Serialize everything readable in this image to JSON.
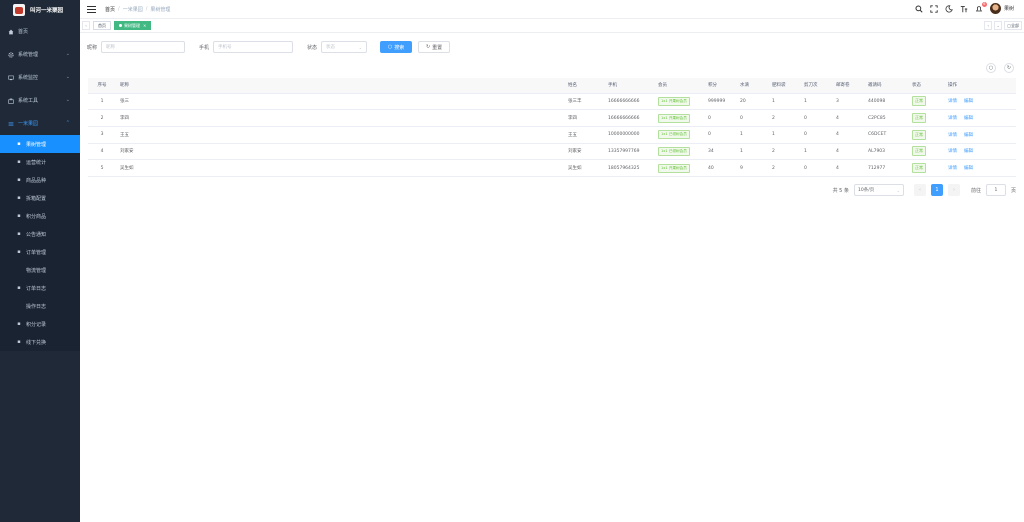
{
  "app": {
    "title": "叫河一米栗园"
  },
  "sidebar": {
    "items": [
      {
        "label": "首页",
        "icon": "home-icon"
      },
      {
        "label": "系统管理",
        "icon": "gear-icon"
      },
      {
        "label": "系统监控",
        "icon": "monitor-icon"
      },
      {
        "label": "系统工具",
        "icon": "toolbox-icon"
      },
      {
        "label": "一米果园",
        "icon": "orchard-icon"
      }
    ],
    "submenu": [
      {
        "label": "果树管理",
        "icon": "user-icon",
        "active": true,
        "deep": false
      },
      {
        "label": "运营统计",
        "icon": "chart-icon",
        "active": false,
        "deep": false
      },
      {
        "label": "商品品种",
        "icon": "list-icon",
        "active": false,
        "deep": false
      },
      {
        "label": "拆箱配置",
        "icon": "edit-icon",
        "active": false,
        "deep": false
      },
      {
        "label": "积分商品",
        "icon": "cart-icon",
        "active": false,
        "deep": false
      },
      {
        "label": "公告通知",
        "icon": "message-icon",
        "active": false,
        "deep": false
      },
      {
        "label": "订单管理",
        "icon": "document-icon",
        "active": false,
        "deep": false
      },
      {
        "label": "物流管理",
        "icon": "",
        "active": false,
        "deep": true
      },
      {
        "label": "订单日志",
        "icon": "log-icon",
        "active": false,
        "deep": false
      },
      {
        "label": "操作日志",
        "icon": "",
        "active": false,
        "deep": true
      },
      {
        "label": "积分记录",
        "icon": "star-icon",
        "active": false,
        "deep": false
      },
      {
        "label": "线下兑换",
        "icon": "send-icon",
        "active": false,
        "deep": false
      }
    ]
  },
  "header": {
    "breadcrumb": [
      "首页",
      "一米果园",
      "果树管理"
    ],
    "username": "果树",
    "notification_count": "6"
  },
  "tags": {
    "items": [
      "首页",
      "果树管理"
    ],
    "close_all": "全部"
  },
  "search": {
    "nickname_label": "昵称",
    "nickname_placeholder": "昵称",
    "phone_label": "手机",
    "phone_placeholder": "手机号",
    "status_label": "状态",
    "status_placeholder": "状态",
    "search_button": "搜索",
    "reset_button": "重置"
  },
  "table": {
    "columns": [
      "序号",
      "昵称",
      "姓名",
      "手机",
      "会员",
      "积分",
      "水滴",
      "肥料袋",
      "剪刀次",
      "邮寄卷",
      "邀请码",
      "状态",
      "操作"
    ],
    "rows": [
      {
        "index": "1",
        "nickname": "张三",
        "name": "张三丰",
        "phone": "16666666666",
        "member": "1x1 开果树会员",
        "points": "999999",
        "water": "20",
        "fertilizer": "1",
        "scissors": "1",
        "mail": "3",
        "invite": "440098",
        "status": "正常"
      },
      {
        "index": "2",
        "nickname": "李四",
        "name": "李四",
        "phone": "16666666666",
        "member": "1x1 开果树会员",
        "points": "0",
        "water": "0",
        "fertilizer": "2",
        "scissors": "0",
        "mail": "4",
        "invite": "C2PC85",
        "status": "正常"
      },
      {
        "index": "3",
        "nickname": "王五",
        "name": "王五",
        "phone": "10000000000",
        "member": "1x1 已领树会员",
        "points": "0",
        "water": "1",
        "fertilizer": "1",
        "scissors": "0",
        "mail": "4",
        "invite": "C6DCET",
        "status": "正常"
      },
      {
        "index": "4",
        "nickname": "刘家安",
        "name": "刘家安",
        "phone": "13357997769",
        "member": "1x1 已领树会员",
        "points": "34",
        "water": "1",
        "fertilizer": "2",
        "scissors": "1",
        "mail": "4",
        "invite": "AL7903",
        "status": "正常"
      },
      {
        "index": "5",
        "nickname": "吴生如",
        "name": "吴生如",
        "phone": "18057964325",
        "member": "1x1 开果树会员",
        "points": "40",
        "water": "9",
        "fertilizer": "2",
        "scissors": "0",
        "mail": "4",
        "invite": "712977",
        "status": "正常"
      }
    ],
    "actions": {
      "detail": "详情",
      "edit": "编辑"
    }
  },
  "pagination": {
    "total_text": "共 5 条",
    "page_size": "10条/页",
    "current_page": "1",
    "goto_label": "前往",
    "goto_value": "1",
    "page_unit": "页"
  },
  "colors": {
    "sidebar_bg": "#1f2937",
    "primary": "#409eff",
    "success": "#67c23a",
    "tag_active": "#42b983"
  }
}
